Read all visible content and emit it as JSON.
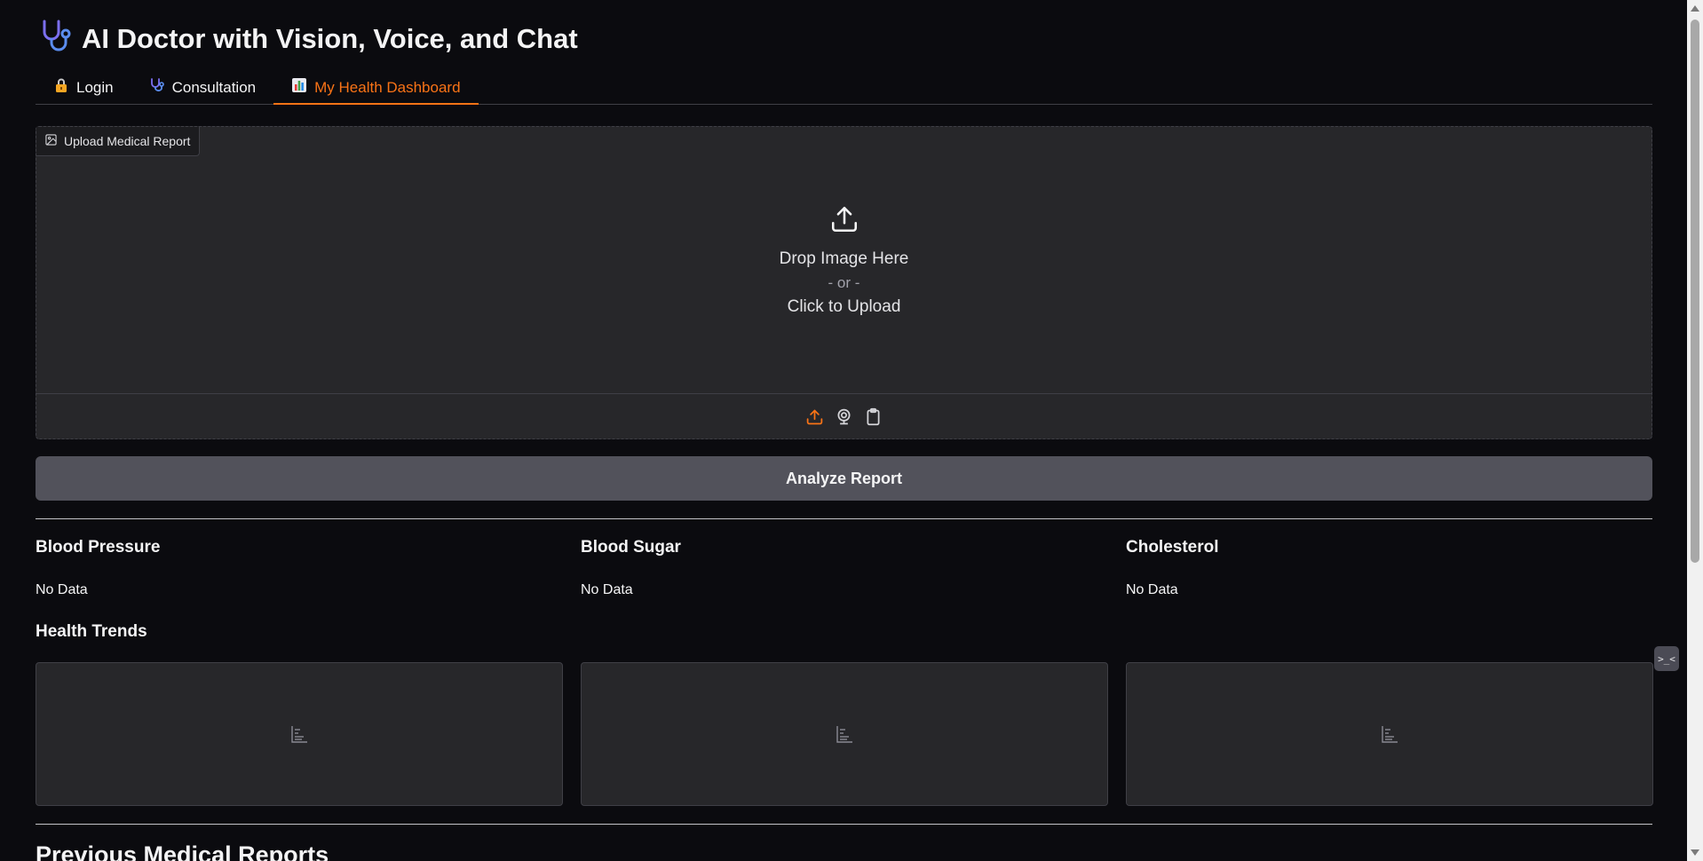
{
  "app": {
    "title": "AI Doctor with Vision, Voice, and Chat",
    "title_icon": "stethoscope-icon"
  },
  "tabs": [
    {
      "label": "Login",
      "icon": "lock-emoji-icon",
      "active": false
    },
    {
      "label": "Consultation",
      "icon": "stethoscope-icon",
      "active": false
    },
    {
      "label": "My Health Dashboard",
      "icon": "bar-chart-emoji-icon",
      "active": true
    }
  ],
  "upload": {
    "label": "Upload Medical Report",
    "drop_text": "Drop Image Here",
    "or_text": "- or -",
    "click_text": "Click to Upload",
    "sources": [
      "upload-icon",
      "webcam-icon",
      "clipboard-icon"
    ]
  },
  "analyze_button": "Analyze Report",
  "metrics": [
    {
      "title": "Blood Pressure",
      "value": "No Data"
    },
    {
      "title": "Blood Sugar",
      "value": "No Data"
    },
    {
      "title": "Cholesterol",
      "value": "No Data"
    }
  ],
  "trends": {
    "heading": "Health Trends",
    "plots": [
      "empty-plot",
      "empty-plot",
      "empty-plot"
    ]
  },
  "previous_reports": {
    "heading": "Previous Medical Reports"
  },
  "floating_widget": {
    "text": ">_<"
  },
  "colors": {
    "accent": "#f97316",
    "background": "#0b0b0f",
    "panel": "#27272a",
    "button": "#52525b"
  }
}
